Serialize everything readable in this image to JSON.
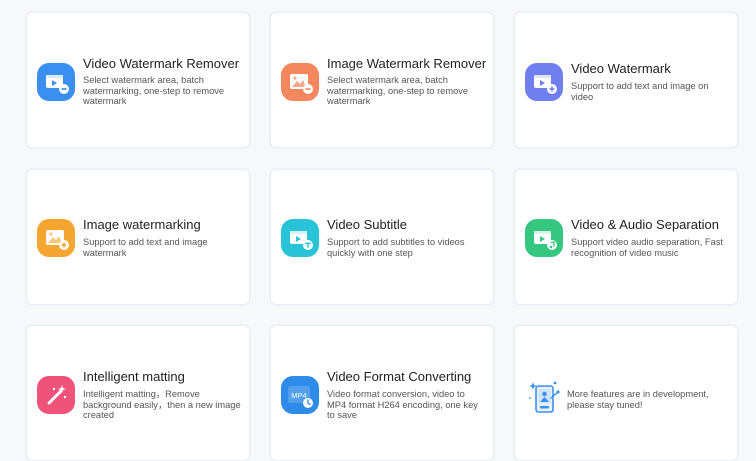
{
  "features": [
    {
      "title": "Video Watermark Remover",
      "desc": "Select watermark area, batch watermarking, one-step to remove watermark",
      "icon": "video-remove-icon",
      "color": "#3b8ff0"
    },
    {
      "title": "Image Watermark Remover",
      "desc": "Select watermark area, batch watermarking, one-step to remove watermark",
      "icon": "image-remove-icon",
      "color": "#f5875f"
    },
    {
      "title": "Video Watermark",
      "desc": "Support to add text and image on video",
      "icon": "video-add-watermark-icon",
      "color": "#6f7ff0"
    },
    {
      "title": "Image watermarking",
      "desc": "Support to add text and image watermark",
      "icon": "image-add-watermark-icon",
      "color": "#f5a630"
    },
    {
      "title": "Video Subtitle",
      "desc": "Support to add subtitles to videos quickly with one step",
      "icon": "video-subtitle-icon",
      "color": "#29c3d8"
    },
    {
      "title": "Video & Audio Separation",
      "desc": "Support video audio separation, Fast recognition of video music",
      "icon": "video-audio-separation-icon",
      "color": "#35c67f"
    },
    {
      "title": "Intelligent matting",
      "desc": "Intelligent matting，Remove background easily，then a new image created",
      "icon": "magic-wand-icon",
      "color": "#f0537a"
    },
    {
      "title": "Video Format Converting",
      "desc": "Video format conversion, video to MP4 format H264 encoding, one key to save",
      "icon": "mp4-convert-icon",
      "color": "#2f8bea",
      "badge": "MP4"
    }
  ],
  "more": {
    "desc": "More features are in development, please stay tuned!",
    "icon": "in-development-icon",
    "color": "#3b8ff0"
  }
}
